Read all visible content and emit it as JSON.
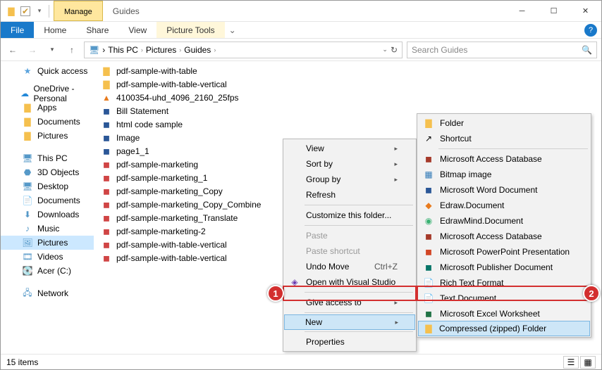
{
  "titlebar": {
    "manage": "Manage",
    "picture_tools": "Picture Tools",
    "title": "Guides"
  },
  "ribbon": {
    "file": "File",
    "home": "Home",
    "share": "Share",
    "view": "View",
    "picture_tools": "Picture Tools"
  },
  "breadcrumb": {
    "this_pc": "This PC",
    "pictures": "Pictures",
    "guides": "Guides"
  },
  "search": {
    "placeholder": "Search Guides"
  },
  "sidebar": {
    "quick_access": "Quick access",
    "onedrive": "OneDrive - Personal",
    "onedrive_items": [
      "Apps",
      "Documents",
      "Pictures"
    ],
    "this_pc": "This PC",
    "this_pc_items": [
      "3D Objects",
      "Desktop",
      "Documents",
      "Downloads",
      "Music",
      "Pictures",
      "Videos",
      "Acer (C:)"
    ],
    "network": "Network"
  },
  "files": [
    {
      "name": "pdf-sample-with-table",
      "icon": "folder"
    },
    {
      "name": "pdf-sample-with-table-vertical",
      "icon": "folder"
    },
    {
      "name": "4100354-uhd_4096_2160_25fps",
      "icon": "vlc"
    },
    {
      "name": "Bill Statement",
      "icon": "doc"
    },
    {
      "name": "html code sample",
      "icon": "doc"
    },
    {
      "name": "Image",
      "icon": "doc"
    },
    {
      "name": "page1_1",
      "icon": "doc"
    },
    {
      "name": "pdf-sample-marketing",
      "icon": "pdf"
    },
    {
      "name": "pdf-sample-marketing_1",
      "icon": "pdf"
    },
    {
      "name": "pdf-sample-marketing_Copy",
      "icon": "pdf"
    },
    {
      "name": "pdf-sample-marketing_Copy_Combine",
      "icon": "pdf"
    },
    {
      "name": "pdf-sample-marketing_Translate",
      "icon": "pdf"
    },
    {
      "name": "pdf-sample-marketing-2",
      "icon": "pdf"
    },
    {
      "name": "pdf-sample-with-table-vertical",
      "icon": "pdf"
    },
    {
      "name": "pdf-sample-with-table-vertical",
      "icon": "pdf"
    }
  ],
  "context_main": {
    "view": "View",
    "sortby": "Sort by",
    "groupby": "Group by",
    "refresh": "Refresh",
    "customize": "Customize this folder...",
    "paste": "Paste",
    "paste_shortcut": "Paste shortcut",
    "undo": "Undo Move",
    "undo_shortcut": "Ctrl+Z",
    "open_vs": "Open with Visual Studio",
    "give_access": "Give access to",
    "new": "New",
    "properties": "Properties"
  },
  "context_new": {
    "folder": "Folder",
    "shortcut": "Shortcut",
    "access": "Microsoft Access Database",
    "bitmap": "Bitmap image",
    "word": "Microsoft Word Document",
    "edraw": "Edraw.Document",
    "edrawmind": "EdrawMind.Document",
    "access2": "Microsoft Access Database",
    "ppt": "Microsoft PowerPoint Presentation",
    "publisher": "Microsoft Publisher Document",
    "rtf": "Rich Text Format",
    "text": "Text Document",
    "excel": "Microsoft Excel Worksheet",
    "zip": "Compressed (zipped) Folder"
  },
  "status": {
    "items": "15 items"
  },
  "annotations": {
    "m1": "1",
    "m2": "2"
  }
}
